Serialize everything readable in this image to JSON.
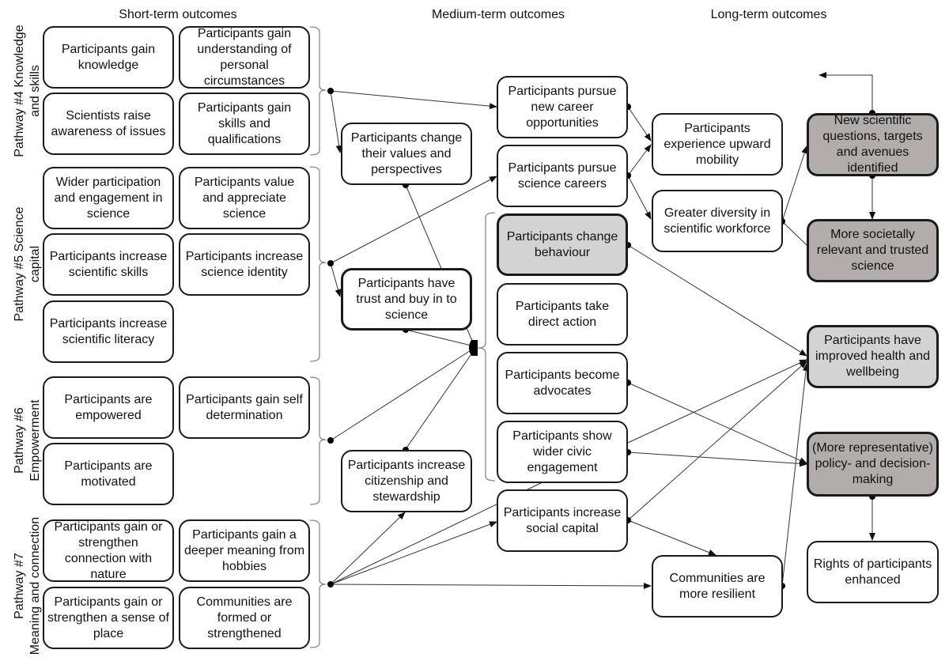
{
  "headers": {
    "short": "Short-term outcomes",
    "medium": "Medium-term outcomes",
    "long": "Long-term outcomes"
  },
  "pathways": [
    {
      "line1": "Pathway #4 Knowledge",
      "line2": "and skills"
    },
    {
      "line1": "Pathway #5 Science",
      "line2": "capital"
    },
    {
      "line1": "Pathway #6",
      "line2": "Empowerment"
    },
    {
      "line1": "Pathway #7",
      "line2": "Meaning and connection"
    }
  ],
  "short_term": {
    "p4_knowledge": "Participants gain knowledge",
    "p4_understanding": "Participants gain understanding of personal circumstances",
    "p4_awareness": "Scientists raise awareness of issues",
    "p4_skills": "Participants gain skills and qualifications",
    "p5_participation": "Wider participation and engagement in science",
    "p5_value": "Participants value and appreciate science",
    "p5_sci_skills": "Participants increase scientific skills",
    "p5_identity": "Participants increase science identity",
    "p5_literacy": "Participants increase scientific literacy",
    "p6_empowered": "Participants are empowered",
    "p6_self_det": "Participants gain self determination",
    "p6_motivated": "Participants are motivated",
    "p7_nature": "Participants gain or strengthen connection with nature",
    "p7_hobbies": "Participants gain a deeper meaning from hobbies",
    "p7_place": "Participants gain or strengthen a sense of place",
    "p7_communities": "Communities are formed or strengthened"
  },
  "medium_term": {
    "values": "Participants change their values and perspectives",
    "trust": "Participants have trust and buy in to science",
    "citizenship": "Participants increase citizenship and stewardship",
    "new_career": "Participants pursue new career opportunities",
    "sci_careers": "Participants pursue science careers",
    "behaviour": "Participants change behaviour",
    "direct_action": "Participants take direct action",
    "advocates": "Participants become advocates",
    "civic": "Participants show wider civic engagement",
    "social_capital": "Participants increase social capital"
  },
  "long_term": {
    "mobility": "Participants experience upward mobility",
    "diversity": "Greater diversity in scientific workforce",
    "resilient": "Communities are more resilient",
    "new_questions": "New scientific questions, targets and avenues identified",
    "relevant_science": "More societally relevant and trusted science",
    "health": "Participants have improved health and wellbeing",
    "policy": "(More representative) policy- and decision-making",
    "rights": "Participants' rights enhanced"
  },
  "rights_label": "Rights of participants enhanced",
  "colors": {
    "light_fill": "#d4d3d3",
    "dark_fill": "#b0adab",
    "line": "#333333",
    "bracket": "#888888"
  }
}
